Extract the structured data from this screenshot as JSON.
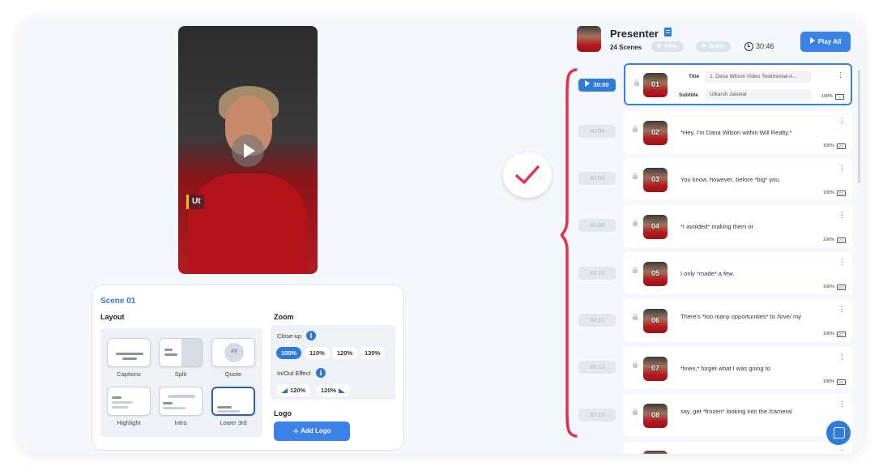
{
  "video": {
    "caption_preview": "Ut"
  },
  "scene_panel": {
    "title": "Scene 01",
    "layout_label": "Layout",
    "layouts": [
      "Captions",
      "Split",
      "Quote",
      "Highlight",
      "Intro",
      "Lower 3rd"
    ],
    "selected_layout": "Lower 3rd",
    "zoom_label": "Zoom",
    "closeup_label": "Close-up",
    "closeup_options": [
      "100%",
      "110%",
      "120%",
      "130%"
    ],
    "closeup_selected": "100%",
    "inout_label": "In/Out Effect",
    "inout_options": [
      "120%",
      "120%"
    ],
    "logo_label": "Logo",
    "add_logo": "Add Logo"
  },
  "header": {
    "name": "Presenter",
    "scene_count": "24 Scenes",
    "intro_pill": "Intro",
    "outro_pill": "Outro",
    "duration": "30:46",
    "play_all": "Play All"
  },
  "scenes": [
    {
      "num": "01",
      "time": "30:00",
      "active": true,
      "title_label": "Title",
      "title_value": "1. Dana Wilson Video Testimonial A...",
      "subtitle_label": "Subtitle",
      "subtitle_value": "Utkarsh Jaiswal",
      "zoom": "100%",
      "cc": "CC"
    },
    {
      "num": "02",
      "time": "30:04",
      "text": "*Hey, I'm Dana Wilson within Will Realty.*",
      "zoom": "100%",
      "cc": "CC"
    },
    {
      "num": "03",
      "time": "30:06",
      "text": "You know, however, before *big* you.",
      "zoom": "100%",
      "cc": "CC"
    },
    {
      "num": "04",
      "time": "30:09",
      "text": "*I avoided* making them or",
      "zoom": "100%",
      "cc": "CC"
    },
    {
      "num": "05",
      "time": "30:10",
      "text": "I only *made* a few.",
      "zoom": "100%",
      "cc": "CC"
    },
    {
      "num": "06",
      "time": "30:11",
      "text": "There's *too many opportunities* to /love/ my",
      "zoom": "100%",
      "cc": "CC"
    },
    {
      "num": "07",
      "time": "30:13",
      "text": "*lines,* forget what I was going to",
      "zoom": "100%",
      "cc": "CC"
    },
    {
      "num": "08",
      "time": "30:15",
      "text": "say, get *frozen* looking into the /camera/",
      "zoom": "100%",
      "cc": "CC"
    }
  ],
  "colors": {
    "accent": "#2f7bd9",
    "bracket": "#e0334a",
    "check": "#e0334a"
  }
}
